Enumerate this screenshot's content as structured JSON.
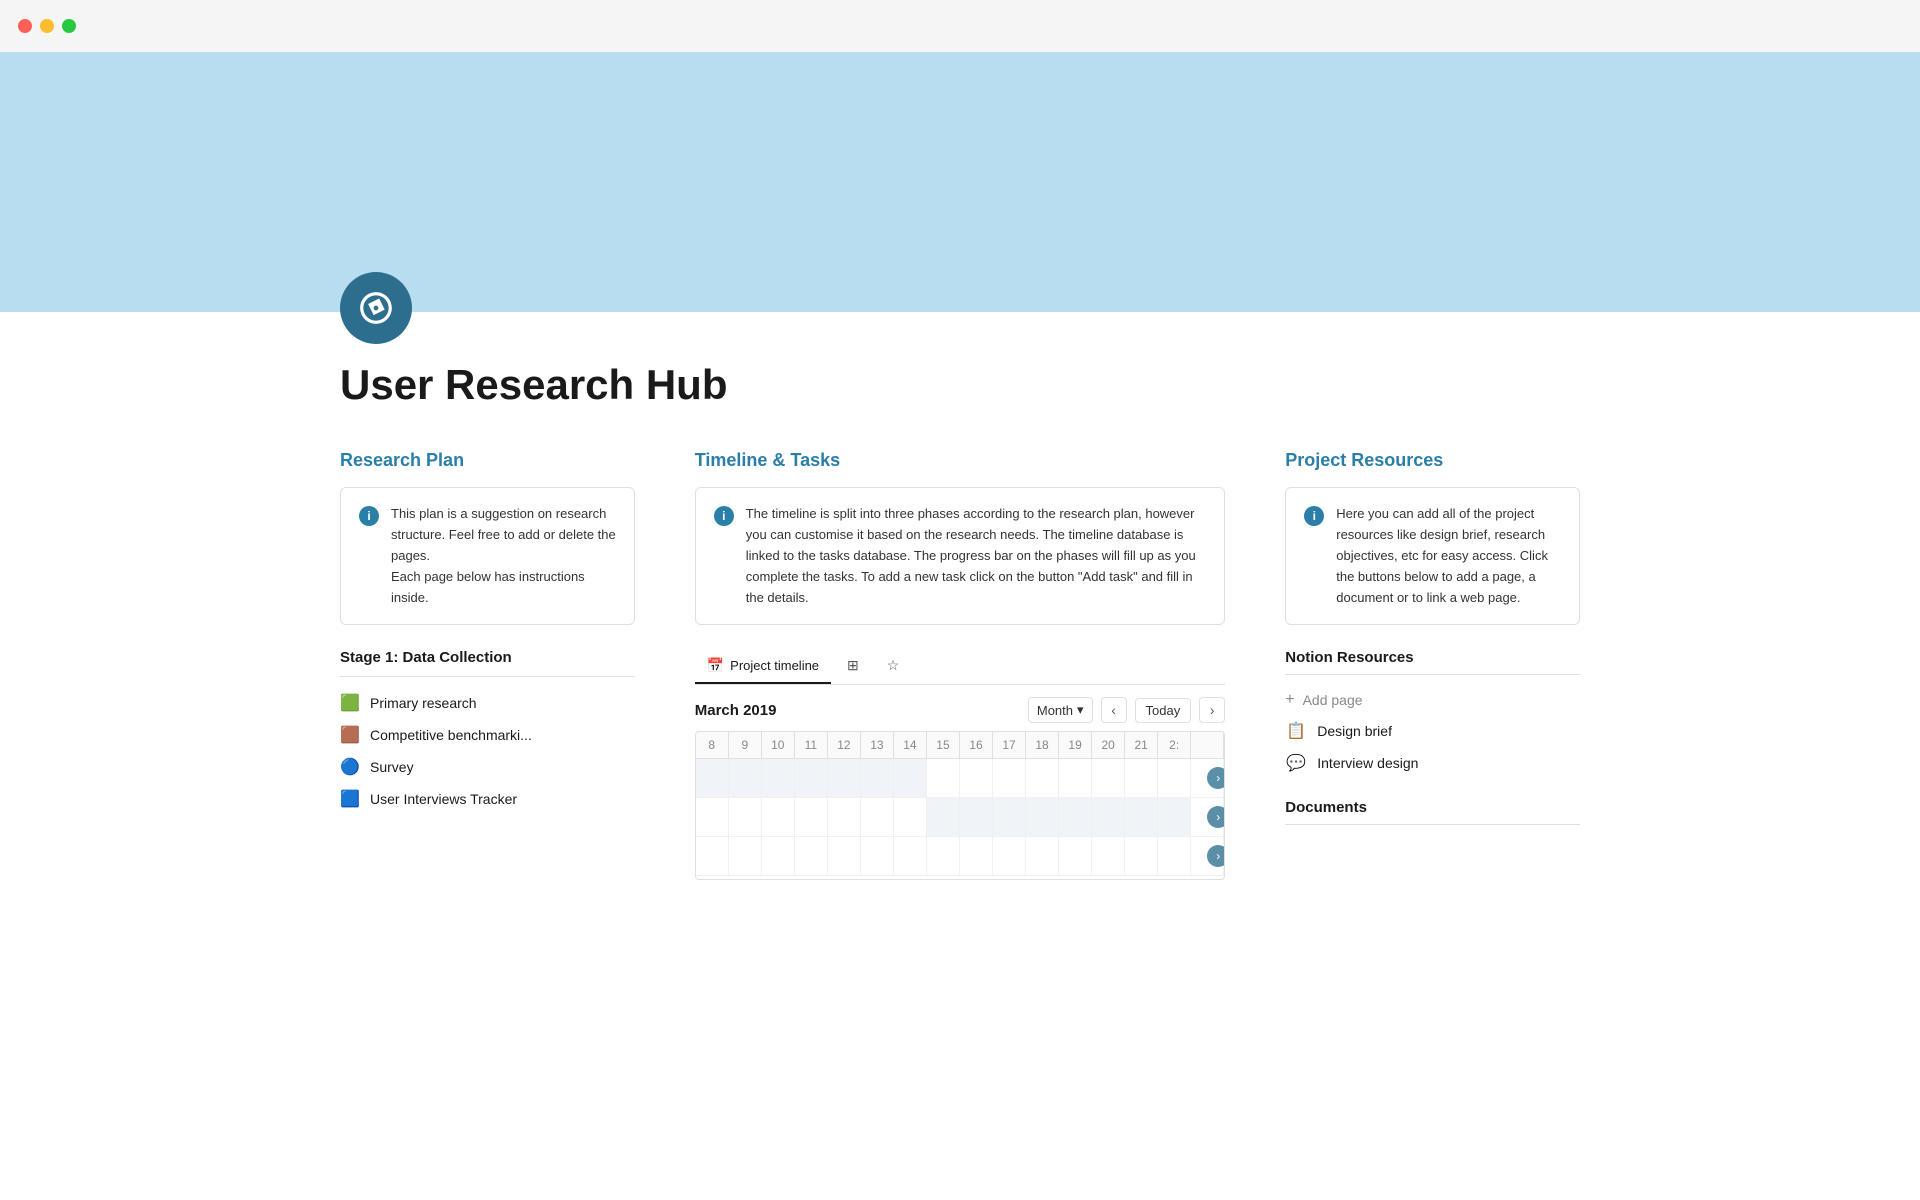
{
  "titlebar": {
    "traffic_lights": [
      "red",
      "yellow",
      "green"
    ]
  },
  "cover": {
    "bg_color": "#b8ddf0"
  },
  "page": {
    "title": "User Research Hub",
    "icon_label": "compass-icon"
  },
  "research_plan": {
    "heading": "Research Plan",
    "info_text": "This plan is a suggestion on research structure. Feel free to add or delete the pages.\nEach page below has instructions inside.",
    "stage1_heading": "Stage 1: Data Collection",
    "nav_items": [
      {
        "icon": "🟩",
        "label": "Primary research"
      },
      {
        "icon": "🟫",
        "label": "Competitive benchmarki..."
      },
      {
        "icon": "🔵",
        "label": "Survey"
      },
      {
        "icon": "🟦",
        "label": "User Interviews Tracker"
      }
    ]
  },
  "timeline_tasks": {
    "heading": "Timeline & Tasks",
    "info_text": "The timeline is split into three phases according to the research plan, however you can customise it based on the research needs. The timeline database is linked to the tasks database. The progress bar on the phases will fill up as you complete the tasks. To add a new task click on the button \"Add task\" and fill in the details.",
    "tabs": [
      {
        "label": "Project timeline",
        "icon": "📅",
        "active": true
      },
      {
        "label": "",
        "icon": "⊞"
      },
      {
        "label": "",
        "icon": "☆"
      }
    ],
    "current_date": "March 2019",
    "view_label": "Month",
    "today_label": "Today",
    "days": [
      "8",
      "9",
      "10",
      "11",
      "12",
      "13",
      "14",
      "15",
      "16",
      "17",
      "18",
      "19",
      "20",
      "21",
      "2:"
    ],
    "rows": 3
  },
  "project_resources": {
    "heading": "Project Resources",
    "info_text": "Here you can add all of the project resources like design brief, research objectives, etc for easy access. Click the buttons below to add a page, a document or to link a web page.",
    "notion_resources_heading": "Notion Resources",
    "add_page_label": "Add page",
    "resource_items": [
      {
        "icon": "📋",
        "label": "Design brief"
      },
      {
        "icon": "💬",
        "label": "Interview design"
      }
    ],
    "documents_heading": "Documents"
  }
}
